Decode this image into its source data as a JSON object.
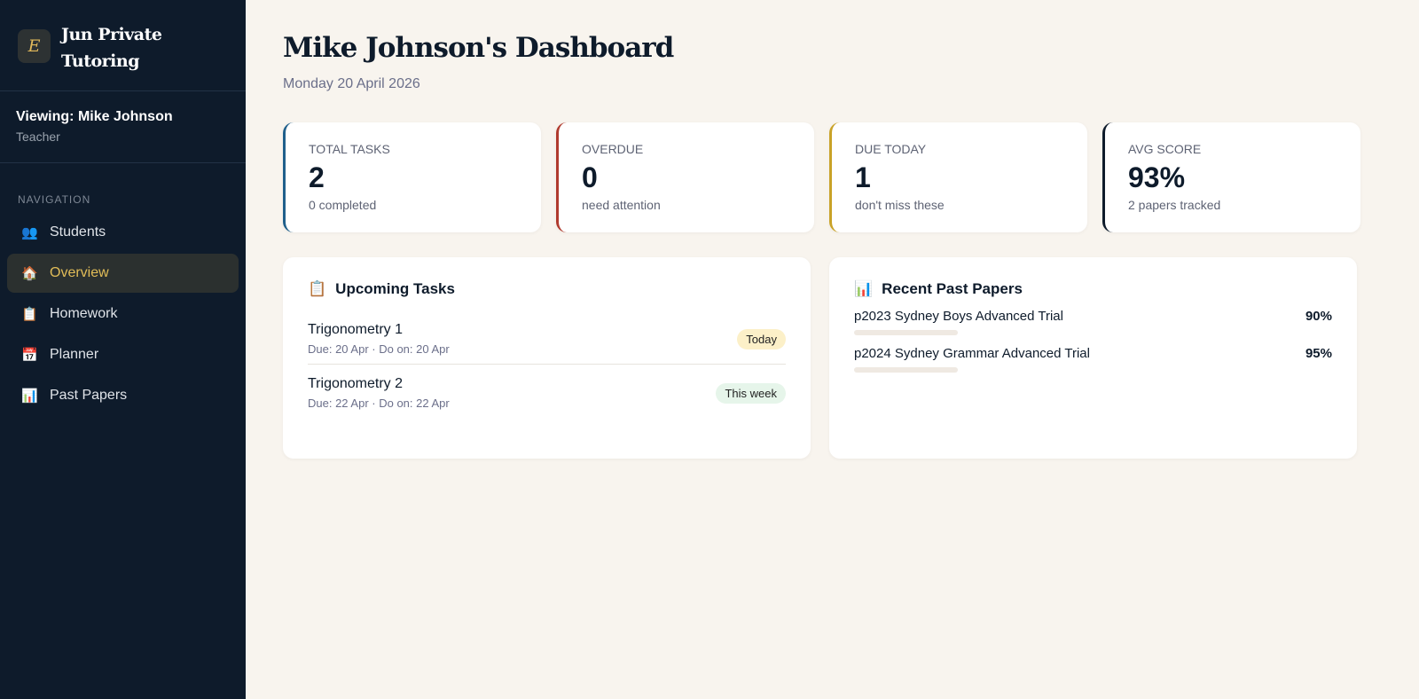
{
  "sidebar": {
    "logo_letter": "E",
    "brand": "Jun Private Tutoring",
    "viewing": "Viewing: Mike Johnson",
    "role": "Teacher",
    "nav_label": "NAVIGATION",
    "items": [
      {
        "icon": "👥",
        "label": "Students"
      },
      {
        "icon": "🏠",
        "label": "Overview"
      },
      {
        "icon": "📋",
        "label": "Homework"
      },
      {
        "icon": "📅",
        "label": "Planner"
      },
      {
        "icon": "📊",
        "label": "Past Papers"
      }
    ]
  },
  "header": {
    "title": "Mike Johnson's Dashboard",
    "date": "Monday 20 April 2026"
  },
  "stats": [
    {
      "label": "Total Tasks",
      "value": "2",
      "sub": "0 completed",
      "color": "#1f5f8b"
    },
    {
      "label": "Overdue",
      "value": "0",
      "sub": "need attention",
      "color": "#b03a2e"
    },
    {
      "label": "Due Today",
      "value": "1",
      "sub": "don't miss these",
      "color": "#c9a227"
    },
    {
      "label": "Avg Score",
      "value": "93%",
      "sub": "2 papers tracked",
      "color": "#0e1b2b"
    }
  ],
  "tasks": {
    "icon": "📋",
    "title": "Upcoming Tasks",
    "items": [
      {
        "name": "Trigonometry 1",
        "meta": "Due: 20 Apr · Do on: 20 Apr",
        "badge": "Today",
        "badge_color": "#fcf0c8"
      },
      {
        "name": "Trigonometry 2",
        "meta": "Due: 22 Apr · Do on: 22 Apr",
        "badge": "This week",
        "badge_color": "#e6f5ea"
      }
    ]
  },
  "papers": {
    "icon": "📊",
    "title": "Recent Past Papers",
    "items": [
      {
        "name": "p2023 Sydney Boys Advanced Trial",
        "score": "90%"
      },
      {
        "name": "p2024 Sydney Grammar Advanced Trial",
        "score": "95%"
      }
    ]
  }
}
